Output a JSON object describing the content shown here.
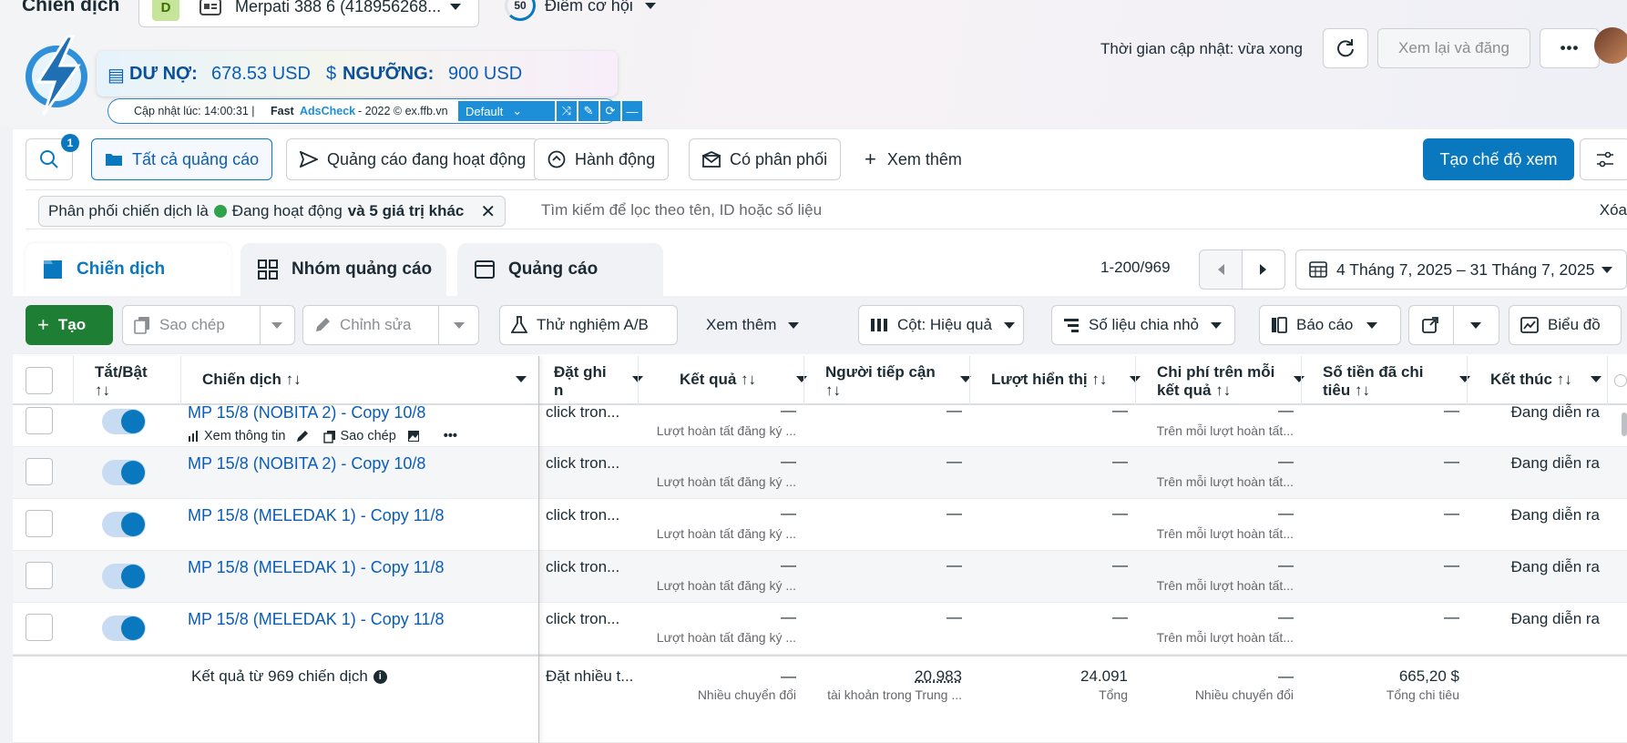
{
  "header": {
    "page_title": "Chiến dịch",
    "account_badge": "D",
    "account_name": "Merpati 388 6 (418956268...",
    "opportunity_score": "50",
    "opportunity_label": "Điểm cơ hội",
    "update_time": "Thời gian cập nhật: vừa xong",
    "review_publish": "Xem lại và đăng",
    "more": "•••"
  },
  "extension": {
    "debt_label": "DƯ NỢ:",
    "debt_value": "678.53 USD",
    "threshold_label": "NGƯỠNG:",
    "threshold_value": "900 USD",
    "update_prefix": "Cập nhật lúc: 14:00:31 |",
    "brand_fast": "Fast",
    "brand_ads": "AdsCheck",
    "brand_suffix": "- 2022 © ex.ffb.vn",
    "preset": "Default"
  },
  "views": {
    "search_badge": "1",
    "all_ads": "Tất cả quảng cáo",
    "active_ads": "Quảng cáo đang hoạt động",
    "actions": "Hành động",
    "delivering": "Có phân phối",
    "see_more": "Xem thêm",
    "create_view": "Tạo chế độ xem"
  },
  "filter": {
    "prefix": "Phân phối chiến dịch là",
    "status": "Đang hoạt động",
    "more": "và 5 giá trị khác",
    "placeholder": "Tìm kiếm để lọc theo tên, ID hoặc số liệu",
    "clear": "Xóa"
  },
  "tabs": {
    "campaigns": "Chiến dịch",
    "adsets": "Nhóm quảng cáo",
    "ads": "Quảng cáo",
    "pagination": "1-200/969",
    "date_range": "4 Tháng 7, 2025 – 31 Tháng 7, 2025"
  },
  "toolbar": {
    "create": "Tạo",
    "duplicate": "Sao chép",
    "edit": "Chỉnh sửa",
    "ab_test": "Thử nghiệm A/B",
    "more": "Xem thêm",
    "columns": "Cột: Hiệu quả",
    "breakdown": "Số liệu chia nhỏ",
    "reports": "Báo cáo",
    "charts": "Biểu đồ"
  },
  "columns": {
    "toggle": "Tắt/Bật",
    "toggle_sort": "↑↓",
    "campaign": "Chiến dịch ↑↓",
    "bid_line1": "Đặt ghi",
    "bid_line2": "n",
    "results": "Kết quả ↑↓",
    "reach_line1": "Người tiếp cận",
    "reach_line2": "↑↓",
    "impressions": "Lượt hiển thị ↑↓",
    "cpr_line1": "Chi phí trên mỗi",
    "cpr_line2": "kết quả ↑↓",
    "spent_line1": "Số tiền đã chi",
    "spent_line2": "tiêu ↑↓",
    "ends": "Kết thúc ↑↓"
  },
  "row_actions": {
    "view": "Xem thông tin",
    "duplicate": "Sao chép",
    "more": "•••"
  },
  "rows": [
    {
      "name": "MP 15/8 (NOBITA 2) - Copy 10/8",
      "bid": "click tron...",
      "result": "—",
      "result_sub": "Lượt hoàn tất đăng ký ...",
      "reach": "—",
      "impr": "—",
      "cpr": "—",
      "cpr_sub": "Trên mỗi lượt hoàn tất...",
      "spent": "—",
      "end": "Đang diễn ra"
    },
    {
      "name": "MP 15/8 (NOBITA 2) - Copy 10/8",
      "bid": "click tron...",
      "result": "—",
      "result_sub": "Lượt hoàn tất đăng ký ...",
      "reach": "—",
      "impr": "—",
      "cpr": "—",
      "cpr_sub": "Trên mỗi lượt hoàn tất...",
      "spent": "—",
      "end": "Đang diễn ra"
    },
    {
      "name": "MP 15/8 (MELEDAK 1) - Copy 11/8",
      "bid": "click tron...",
      "result": "—",
      "result_sub": "Lượt hoàn tất đăng ký ...",
      "reach": "—",
      "impr": "—",
      "cpr": "—",
      "cpr_sub": "Trên mỗi lượt hoàn tất...",
      "spent": "—",
      "end": "Đang diễn ra"
    },
    {
      "name": "MP 15/8 (MELEDAK 1) - Copy 11/8",
      "bid": "click tron...",
      "result": "—",
      "result_sub": "Lượt hoàn tất đăng ký ...",
      "reach": "—",
      "impr": "—",
      "cpr": "—",
      "cpr_sub": "Trên mỗi lượt hoàn tất...",
      "spent": "—",
      "end": "Đang diễn ra"
    },
    {
      "name": "MP 15/8 (MELEDAK 1) - Copy 11/8",
      "bid": "click tron...",
      "result": "—",
      "result_sub": "Lượt hoàn tất đăng ký ...",
      "reach": "—",
      "impr": "—",
      "cpr": "—",
      "cpr_sub": "Trên mỗi lượt hoàn tất...",
      "spent": "—",
      "end": "Đang diễn ra"
    }
  ],
  "totals": {
    "label": "Kết quả từ 969 chiến dịch",
    "bid": "Đặt nhiều t...",
    "result": "—",
    "result_sub": "Nhiều chuyển đổi",
    "reach": "20.983",
    "reach_sub": "tài khoản trong Trung ...",
    "impr": "24.091",
    "impr_sub": "Tổng",
    "cpr": "—",
    "cpr_sub": "Nhiều chuyển đổi",
    "spent": "665,20 $",
    "spent_sub": "Tổng chi tiêu"
  },
  "colors": {
    "accent": "#0a78be",
    "create_green": "#1e7e34",
    "active_dot": "#31a24c"
  }
}
